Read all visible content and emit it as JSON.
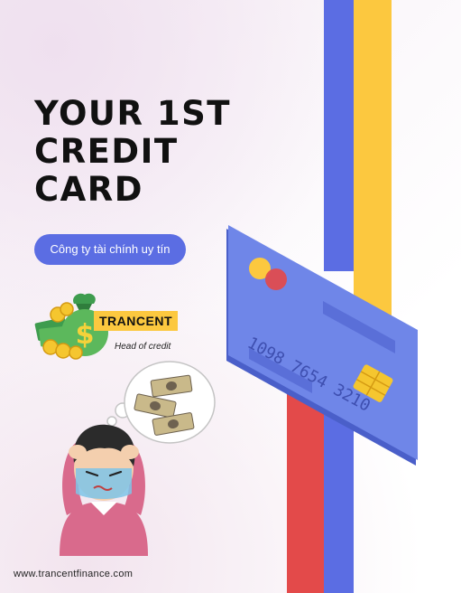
{
  "headline": {
    "line1": "YOUR 1ST",
    "line2": "CREDIT",
    "line3": "CARD"
  },
  "company_tagline": "Công ty tài chính uy tín",
  "brand": {
    "name": "TRANCENT",
    "role": "Head of credit"
  },
  "card": {
    "number": "1098 7654 3210"
  },
  "footer": {
    "website": "www.trancentfinance.com"
  },
  "colors": {
    "accent_blue": "#5b6de3",
    "accent_yellow": "#fcc83f",
    "accent_red": "#e34a4a",
    "card_blue": "#6f86e8",
    "text": "#111111"
  },
  "icons": [
    "money-bag-icon",
    "credit-card-icon",
    "chip-icon",
    "thought-bubble-icon",
    "cash-icon",
    "worried-person-illustration"
  ]
}
